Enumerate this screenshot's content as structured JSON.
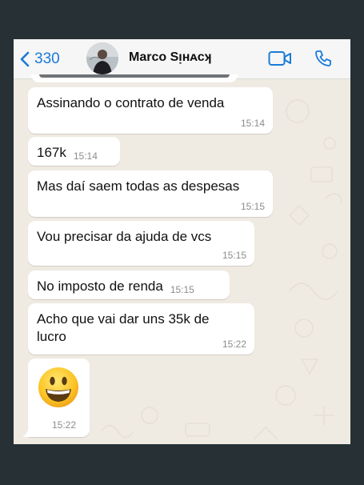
{
  "header": {
    "back_label": "330",
    "contact_name": "Marco Sᴉʜᴀᴄʞ"
  },
  "messages": [
    {
      "text": "Assinando o contrato de venda",
      "time": "15:14"
    },
    {
      "text": "167k",
      "time": "15:14"
    },
    {
      "text": "Mas daí saem todas as despesas",
      "time": "15:15"
    },
    {
      "text": "Vou precisar da ajuda de vcs",
      "time": "15:15"
    },
    {
      "text": "No imposto de renda",
      "time": "15:15"
    },
    {
      "text": "Acho que vai dar uns 35k de lucro",
      "time": "15:22"
    },
    {
      "emoji": "grinning-face",
      "time": "15:22"
    }
  ],
  "colors": {
    "accent": "#1a7ad8",
    "chat_background": "#efeae2",
    "bubble": "#ffffff",
    "frame": "#273135"
  }
}
